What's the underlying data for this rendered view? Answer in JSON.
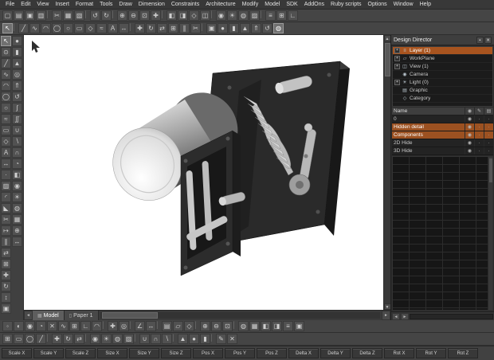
{
  "colors": {
    "selection": "#a8541f",
    "canvas": "#ffffff",
    "chrome": "#454545"
  },
  "menu": {
    "items": [
      "File",
      "Edit",
      "View",
      "Insert",
      "Format",
      "Tools",
      "Draw",
      "Dimension",
      "Constraints",
      "Architecture",
      "Modify",
      "Model",
      "SDK",
      "AddOns",
      "Ruby scripts",
      "Options",
      "Window",
      "Help"
    ]
  },
  "toolbar_top1": {
    "icons": [
      {
        "name": "new-icon",
        "glyph": "▢"
      },
      {
        "name": "open-icon",
        "glyph": "▤"
      },
      {
        "name": "save-icon",
        "glyph": "▣"
      },
      {
        "name": "print-icon",
        "glyph": "▥"
      },
      {
        "name": "separator",
        "glyph": "▏"
      },
      {
        "name": "cut-icon",
        "glyph": "✂"
      },
      {
        "name": "copy-icon",
        "glyph": "▦"
      },
      {
        "name": "paste-icon",
        "glyph": "▧"
      },
      {
        "name": "separator",
        "glyph": "▏"
      },
      {
        "name": "undo-icon",
        "glyph": "↺"
      },
      {
        "name": "redo-icon",
        "glyph": "↻"
      },
      {
        "name": "separator",
        "glyph": "▏"
      },
      {
        "name": "zoom-in-icon",
        "glyph": "⊕"
      },
      {
        "name": "zoom-out-icon",
        "glyph": "⊖"
      },
      {
        "name": "zoom-extents-icon",
        "glyph": "⊡"
      },
      {
        "name": "pan-icon",
        "glyph": "✚"
      },
      {
        "name": "separator",
        "glyph": "▏"
      },
      {
        "name": "view-left-icon",
        "glyph": "◧"
      },
      {
        "name": "view-right-icon",
        "glyph": "◨"
      },
      {
        "name": "view-iso-icon",
        "glyph": "◇"
      },
      {
        "name": "view-front-icon",
        "glyph": "◫"
      },
      {
        "name": "separator",
        "glyph": "▏"
      },
      {
        "name": "camera-icon",
        "glyph": "◉"
      },
      {
        "name": "light-icon",
        "glyph": "☀"
      },
      {
        "name": "render-icon",
        "glyph": "◍"
      },
      {
        "name": "materials-icon",
        "glyph": "▨"
      },
      {
        "name": "separator",
        "glyph": "▏"
      },
      {
        "name": "layers-icon",
        "glyph": "≡"
      },
      {
        "name": "grid-icon",
        "glyph": "⊞"
      },
      {
        "name": "ortho-icon",
        "glyph": "∟"
      }
    ]
  },
  "toolbar_top2": {
    "icons": [
      {
        "name": "select-tool-icon",
        "glyph": "↖",
        "selected": true
      },
      {
        "name": "separator",
        "glyph": "▏"
      },
      {
        "name": "line-tool-icon",
        "glyph": "╱"
      },
      {
        "name": "polyline-tool-icon",
        "glyph": "∿"
      },
      {
        "name": "arc-tool-icon",
        "glyph": "◠"
      },
      {
        "name": "circle-tool-icon",
        "glyph": "◯"
      },
      {
        "name": "ellipse-tool-icon",
        "glyph": "○"
      },
      {
        "name": "rectangle-tool-icon",
        "glyph": "▭"
      },
      {
        "name": "polygon-tool-icon",
        "glyph": "◇"
      },
      {
        "name": "spline-tool-icon",
        "glyph": "≈"
      },
      {
        "name": "text-tool-icon",
        "glyph": "A"
      },
      {
        "name": "dimension-tool-icon",
        "glyph": "↔"
      },
      {
        "name": "separator",
        "glyph": "▏"
      },
      {
        "name": "move-tool-icon",
        "glyph": "✚"
      },
      {
        "name": "rotate-tool-icon",
        "glyph": "↻"
      },
      {
        "name": "mirror-tool-icon",
        "glyph": "⇄"
      },
      {
        "name": "array-tool-icon",
        "glyph": "⊞"
      },
      {
        "name": "offset-tool-icon",
        "glyph": "∥"
      },
      {
        "name": "trim-tool-icon",
        "glyph": "✂"
      },
      {
        "name": "separator",
        "glyph": "▏"
      },
      {
        "name": "box-tool-icon",
        "glyph": "▣"
      },
      {
        "name": "sphere-tool-icon",
        "glyph": "●"
      },
      {
        "name": "cylinder-tool-icon",
        "glyph": "▮"
      },
      {
        "name": "cone-tool-icon",
        "glyph": "▲"
      },
      {
        "name": "extrude-tool-icon",
        "glyph": "⇑"
      },
      {
        "name": "revolve-tool-icon",
        "glyph": "↺"
      },
      {
        "name": "render-mode-icon",
        "glyph": "◍",
        "selected": true
      }
    ]
  },
  "left_toolbar": {
    "icons": [
      {
        "name": "select-icon",
        "glyph": "↖",
        "selected": true
      },
      {
        "name": "node-edit-icon",
        "glyph": "⊙"
      },
      {
        "name": "line-icon",
        "glyph": "╱"
      },
      {
        "name": "polyline-icon",
        "glyph": "∿"
      },
      {
        "name": "arc-icon",
        "glyph": "◠"
      },
      {
        "name": "circle-icon",
        "glyph": "◯"
      },
      {
        "name": "ellipse-icon",
        "glyph": "○"
      },
      {
        "name": "spline-icon",
        "glyph": "≈"
      },
      {
        "name": "rectangle-icon",
        "glyph": "▭"
      },
      {
        "name": "polygon-icon",
        "glyph": "◇"
      },
      {
        "name": "text-icon",
        "glyph": "A"
      },
      {
        "name": "dimension-icon",
        "glyph": "↔"
      },
      {
        "name": "point-icon",
        "glyph": "·"
      },
      {
        "name": "hatch-icon",
        "glyph": "▨"
      },
      {
        "name": "fillet-icon",
        "glyph": "◜"
      },
      {
        "name": "chamfer-icon",
        "glyph": "◣"
      },
      {
        "name": "trim-icon",
        "glyph": "✂"
      },
      {
        "name": "extend-icon",
        "glyph": "↦"
      },
      {
        "name": "offset-icon",
        "glyph": "∥"
      },
      {
        "name": "mirror-icon",
        "glyph": "⇄"
      },
      {
        "name": "array-icon",
        "glyph": "⊞"
      },
      {
        "name": "move-icon",
        "glyph": "✚"
      },
      {
        "name": "rotate-icon",
        "glyph": "↻"
      },
      {
        "name": "scale-icon",
        "glyph": "↕"
      },
      {
        "name": "box-icon",
        "glyph": "▣"
      },
      {
        "name": "sphere-icon",
        "glyph": "●"
      },
      {
        "name": "cylinder-icon",
        "glyph": "▮"
      },
      {
        "name": "cone-icon",
        "glyph": "▲"
      },
      {
        "name": "torus-icon",
        "glyph": "◎"
      },
      {
        "name": "extrude-icon",
        "glyph": "⇑"
      },
      {
        "name": "revolve-icon",
        "glyph": "↺"
      },
      {
        "name": "sweep-icon",
        "glyph": "∫"
      },
      {
        "name": "loft-icon",
        "glyph": "∬"
      },
      {
        "name": "boolean-union-icon",
        "glyph": "∪"
      },
      {
        "name": "boolean-subtract-icon",
        "glyph": "∖"
      },
      {
        "name": "boolean-intersect-icon",
        "glyph": "∩"
      },
      {
        "name": "shell-icon",
        "glyph": "◔"
      },
      {
        "name": "facet-edit-icon",
        "glyph": "◧"
      },
      {
        "name": "camera-icon",
        "glyph": "◉"
      },
      {
        "name": "light-icon",
        "glyph": "☀"
      },
      {
        "name": "render-icon",
        "glyph": "◍"
      },
      {
        "name": "material-icon",
        "glyph": "▦"
      },
      {
        "name": "zoom-icon",
        "glyph": "⊕"
      },
      {
        "name": "pan-icon",
        "glyph": "↔"
      }
    ]
  },
  "design_director": {
    "title": "Design Director",
    "title_buttons": [
      {
        "name": "pin-button",
        "glyph": "▪"
      },
      {
        "name": "close-button",
        "glyph": "✕"
      }
    ],
    "tree": [
      {
        "exp": "+",
        "glyph": "≡",
        "label": "Layer (1)",
        "selected": true
      },
      {
        "exp": "+",
        "glyph": "▱",
        "label": "WorkPlane"
      },
      {
        "exp": "+",
        "glyph": "◫",
        "label": "View (1)"
      },
      {
        "exp": "",
        "glyph": "◉",
        "label": "Camera"
      },
      {
        "exp": "+",
        "glyph": "☀",
        "label": "Light (0)"
      },
      {
        "exp": "",
        "glyph": "▤",
        "label": "Graphic"
      },
      {
        "exp": "",
        "glyph": "◇",
        "label": "Category"
      }
    ],
    "layers_table": {
      "name_header": "Name",
      "columns": [
        {
          "name": "visible-column-icon",
          "glyph": "◉"
        },
        {
          "name": "editable-column-icon",
          "glyph": "✎"
        },
        {
          "name": "print-column-icon",
          "glyph": "▤"
        }
      ],
      "rows": [
        {
          "name": "0",
          "eye": "◉",
          "c2": "·",
          "c3": "·"
        },
        {
          "name": "Hidden detail",
          "eye": "◉",
          "c2": "·",
          "c3": "·",
          "selected": true
        },
        {
          "name": "Components",
          "eye": "◉",
          "c2": "·",
          "c3": "·",
          "selected": true
        },
        {
          "name": "2D Hide",
          "eye": "◉",
          "c2": "·",
          "c3": "·"
        },
        {
          "name": "3D Hide",
          "eye": "◉",
          "c2": "·",
          "c3": "·"
        }
      ]
    },
    "scroll_left": "◄",
    "scroll_right": "►"
  },
  "tabs": {
    "scroll_left": "◄",
    "scroll_right": "►",
    "items": [
      {
        "name": "tab-model",
        "label": "Model",
        "glyph": "▦",
        "selected": true
      },
      {
        "name": "tab-paper-1",
        "label": "Paper 1",
        "glyph": "▯"
      }
    ]
  },
  "toolbar_bottom1": {
    "icons": [
      {
        "name": "vertex-snap-icon",
        "glyph": "◦"
      },
      {
        "name": "midpoint-snap-icon",
        "glyph": "◐"
      },
      {
        "name": "center-snap-icon",
        "glyph": "◉"
      },
      {
        "name": "quadrant-snap-icon",
        "glyph": "◔"
      },
      {
        "name": "intersection-snap-icon",
        "glyph": "✕"
      },
      {
        "name": "nearest-snap-icon",
        "glyph": "∿"
      },
      {
        "name": "grid-snap-icon",
        "glyph": "⊞"
      },
      {
        "name": "perpendicular-snap-icon",
        "glyph": "∟"
      },
      {
        "name": "tangent-snap-icon",
        "glyph": "◠"
      },
      {
        "name": "separator",
        "glyph": "▏"
      },
      {
        "name": "no-snap-icon",
        "glyph": "✚"
      },
      {
        "name": "aperture-icon",
        "glyph": "◎"
      },
      {
        "name": "separator",
        "glyph": "▏"
      },
      {
        "name": "angle-icon",
        "glyph": "∠"
      },
      {
        "name": "distance-icon",
        "glyph": "↔"
      },
      {
        "name": "separator",
        "glyph": "▏"
      },
      {
        "name": "workplane-by-face-icon",
        "glyph": "▤"
      },
      {
        "name": "workplane-origin-icon",
        "glyph": "▱"
      },
      {
        "name": "workplane-3pt-icon",
        "glyph": "◇"
      },
      {
        "name": "separator",
        "glyph": "▏"
      },
      {
        "name": "zoom-window-icon",
        "glyph": "⊕"
      },
      {
        "name": "zoom-previous-icon",
        "glyph": "⊖"
      },
      {
        "name": "zoom-all-icon",
        "glyph": "⊡"
      },
      {
        "name": "separator",
        "glyph": "▏"
      },
      {
        "name": "draw-order-icon",
        "glyph": "◍"
      },
      {
        "name": "material-icon",
        "glyph": "▦"
      },
      {
        "name": "view-left-icon",
        "glyph": "◧"
      },
      {
        "name": "view-right-icon",
        "glyph": "◨"
      },
      {
        "name": "layers-icon",
        "glyph": "≡"
      },
      {
        "name": "settings-icon",
        "glyph": "▣"
      }
    ]
  },
  "toolbar_bottom2": {
    "icons": [
      {
        "name": "grid-toggle-icon",
        "glyph": "⊞"
      },
      {
        "name": "rect-mode-icon",
        "glyph": "▭"
      },
      {
        "name": "circle-mode-icon",
        "glyph": "◯"
      },
      {
        "name": "line-mode-icon",
        "glyph": "╱"
      },
      {
        "name": "separator",
        "glyph": "▏"
      },
      {
        "name": "move-mode-icon",
        "glyph": "✚"
      },
      {
        "name": "rotate-mode-icon",
        "glyph": "↻"
      },
      {
        "name": "mirror-mode-icon",
        "glyph": "⇄"
      },
      {
        "name": "separator",
        "glyph": "▏"
      },
      {
        "name": "camera-mode-icon",
        "glyph": "◉"
      },
      {
        "name": "light-mode-icon",
        "glyph": "☀"
      },
      {
        "name": "render-mode-icon",
        "glyph": "◍"
      },
      {
        "name": "material-mode-icon",
        "glyph": "▨"
      },
      {
        "name": "separator",
        "glyph": "▏"
      },
      {
        "name": "union-mode-icon",
        "glyph": "∪"
      },
      {
        "name": "intersect-mode-icon",
        "glyph": "∩"
      },
      {
        "name": "subtract-mode-icon",
        "glyph": "∖"
      },
      {
        "name": "separator",
        "glyph": "▏"
      },
      {
        "name": "cone-mode-icon",
        "glyph": "▲"
      },
      {
        "name": "sphere-mode-icon",
        "glyph": "●"
      },
      {
        "name": "cylinder-mode-icon",
        "glyph": "▮"
      },
      {
        "name": "separator",
        "glyph": "▏"
      },
      {
        "name": "edit-mode-icon",
        "glyph": "✎"
      },
      {
        "name": "delete-mode-icon",
        "glyph": "✕"
      }
    ]
  },
  "status_bar": {
    "fields": [
      "Scale X",
      "Scale Y",
      "Scale Z",
      "Size X",
      "Size Y",
      "Size Z",
      "Pos X",
      "Pos Y",
      "Pos Z",
      "Delta X",
      "Delta Y",
      "Delta Z",
      "Rot X",
      "Rot Y",
      "Rot Z"
    ]
  }
}
